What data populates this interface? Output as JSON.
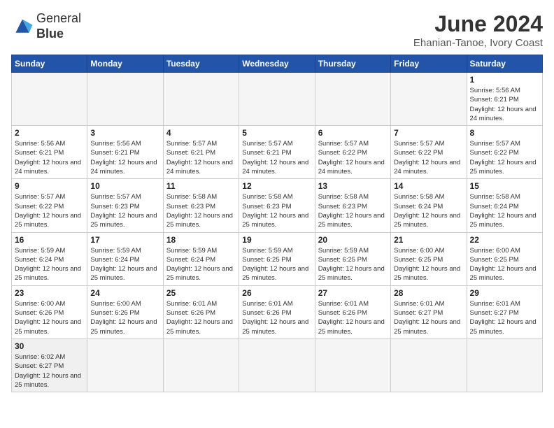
{
  "logo": {
    "text_general": "General",
    "text_blue": "Blue"
  },
  "header": {
    "month_year": "June 2024",
    "location": "Ehanian-Tanoe, Ivory Coast"
  },
  "weekdays": [
    "Sunday",
    "Monday",
    "Tuesday",
    "Wednesday",
    "Thursday",
    "Friday",
    "Saturday"
  ],
  "weeks": [
    [
      {
        "day": "",
        "empty": true
      },
      {
        "day": "",
        "empty": true
      },
      {
        "day": "",
        "empty": true
      },
      {
        "day": "",
        "empty": true
      },
      {
        "day": "",
        "empty": true
      },
      {
        "day": "",
        "empty": true
      },
      {
        "day": "1",
        "sunrise": "5:56 AM",
        "sunset": "6:21 PM",
        "daylight": "12 hours and 24 minutes."
      }
    ],
    [
      {
        "day": "2",
        "sunrise": "5:56 AM",
        "sunset": "6:21 PM",
        "daylight": "12 hours and 24 minutes."
      },
      {
        "day": "3",
        "sunrise": "5:56 AM",
        "sunset": "6:21 PM",
        "daylight": "12 hours and 24 minutes."
      },
      {
        "day": "4",
        "sunrise": "5:57 AM",
        "sunset": "6:21 PM",
        "daylight": "12 hours and 24 minutes."
      },
      {
        "day": "5",
        "sunrise": "5:57 AM",
        "sunset": "6:21 PM",
        "daylight": "12 hours and 24 minutes."
      },
      {
        "day": "6",
        "sunrise": "5:57 AM",
        "sunset": "6:22 PM",
        "daylight": "12 hours and 24 minutes."
      },
      {
        "day": "7",
        "sunrise": "5:57 AM",
        "sunset": "6:22 PM",
        "daylight": "12 hours and 24 minutes."
      },
      {
        "day": "8",
        "sunrise": "5:57 AM",
        "sunset": "6:22 PM",
        "daylight": "12 hours and 25 minutes."
      }
    ],
    [
      {
        "day": "9",
        "sunrise": "5:57 AM",
        "sunset": "6:22 PM",
        "daylight": "12 hours and 25 minutes."
      },
      {
        "day": "10",
        "sunrise": "5:57 AM",
        "sunset": "6:23 PM",
        "daylight": "12 hours and 25 minutes."
      },
      {
        "day": "11",
        "sunrise": "5:58 AM",
        "sunset": "6:23 PM",
        "daylight": "12 hours and 25 minutes."
      },
      {
        "day": "12",
        "sunrise": "5:58 AM",
        "sunset": "6:23 PM",
        "daylight": "12 hours and 25 minutes."
      },
      {
        "day": "13",
        "sunrise": "5:58 AM",
        "sunset": "6:23 PM",
        "daylight": "12 hours and 25 minutes."
      },
      {
        "day": "14",
        "sunrise": "5:58 AM",
        "sunset": "6:24 PM",
        "daylight": "12 hours and 25 minutes."
      },
      {
        "day": "15",
        "sunrise": "5:58 AM",
        "sunset": "6:24 PM",
        "daylight": "12 hours and 25 minutes."
      }
    ],
    [
      {
        "day": "16",
        "sunrise": "5:59 AM",
        "sunset": "6:24 PM",
        "daylight": "12 hours and 25 minutes."
      },
      {
        "day": "17",
        "sunrise": "5:59 AM",
        "sunset": "6:24 PM",
        "daylight": "12 hours and 25 minutes."
      },
      {
        "day": "18",
        "sunrise": "5:59 AM",
        "sunset": "6:24 PM",
        "daylight": "12 hours and 25 minutes."
      },
      {
        "day": "19",
        "sunrise": "5:59 AM",
        "sunset": "6:25 PM",
        "daylight": "12 hours and 25 minutes."
      },
      {
        "day": "20",
        "sunrise": "5:59 AM",
        "sunset": "6:25 PM",
        "daylight": "12 hours and 25 minutes."
      },
      {
        "day": "21",
        "sunrise": "6:00 AM",
        "sunset": "6:25 PM",
        "daylight": "12 hours and 25 minutes."
      },
      {
        "day": "22",
        "sunrise": "6:00 AM",
        "sunset": "6:25 PM",
        "daylight": "12 hours and 25 minutes."
      }
    ],
    [
      {
        "day": "23",
        "sunrise": "6:00 AM",
        "sunset": "6:26 PM",
        "daylight": "12 hours and 25 minutes."
      },
      {
        "day": "24",
        "sunrise": "6:00 AM",
        "sunset": "6:26 PM",
        "daylight": "12 hours and 25 minutes."
      },
      {
        "day": "25",
        "sunrise": "6:01 AM",
        "sunset": "6:26 PM",
        "daylight": "12 hours and 25 minutes."
      },
      {
        "day": "26",
        "sunrise": "6:01 AM",
        "sunset": "6:26 PM",
        "daylight": "12 hours and 25 minutes."
      },
      {
        "day": "27",
        "sunrise": "6:01 AM",
        "sunset": "6:26 PM",
        "daylight": "12 hours and 25 minutes."
      },
      {
        "day": "28",
        "sunrise": "6:01 AM",
        "sunset": "6:27 PM",
        "daylight": "12 hours and 25 minutes."
      },
      {
        "day": "29",
        "sunrise": "6:01 AM",
        "sunset": "6:27 PM",
        "daylight": "12 hours and 25 minutes."
      }
    ],
    [
      {
        "day": "30",
        "sunrise": "6:02 AM",
        "sunset": "6:27 PM",
        "daylight": "12 hours and 25 minutes."
      },
      {
        "day": "",
        "empty": true
      },
      {
        "day": "",
        "empty": true
      },
      {
        "day": "",
        "empty": true
      },
      {
        "day": "",
        "empty": true
      },
      {
        "day": "",
        "empty": true
      },
      {
        "day": "",
        "empty": true
      }
    ]
  ]
}
